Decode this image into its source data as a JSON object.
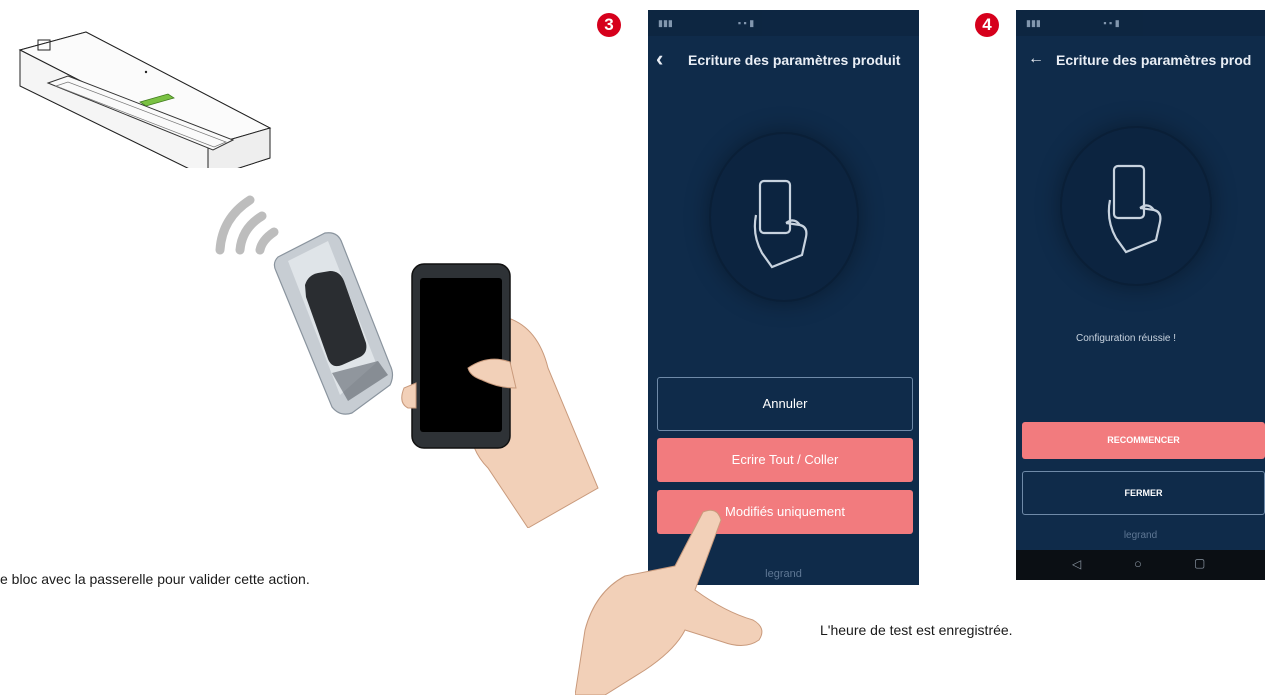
{
  "badges": {
    "step3": "3",
    "step4": "4"
  },
  "left_caption": "e bloc avec la passerelle pour valider cette action.",
  "right_caption": "L'heure de test est enregistrée.",
  "screen3": {
    "title": "Ecriture des paramètres produit",
    "buttons": {
      "cancel": "Annuler",
      "write_all": "Ecrire Tout / Coller",
      "modified_only": "Modifiés uniquement"
    },
    "footer": "legrand"
  },
  "screen4": {
    "title": "Ecriture des paramètres prod",
    "message": "Configuration réussie !",
    "buttons": {
      "restart": "RECOMMENCER",
      "close": "FERMER"
    },
    "footer": "legrand"
  },
  "colors": {
    "phone_bg": "#0f2b4a",
    "button_pink": "#f27b7e",
    "badge_red": "#d6001c"
  }
}
